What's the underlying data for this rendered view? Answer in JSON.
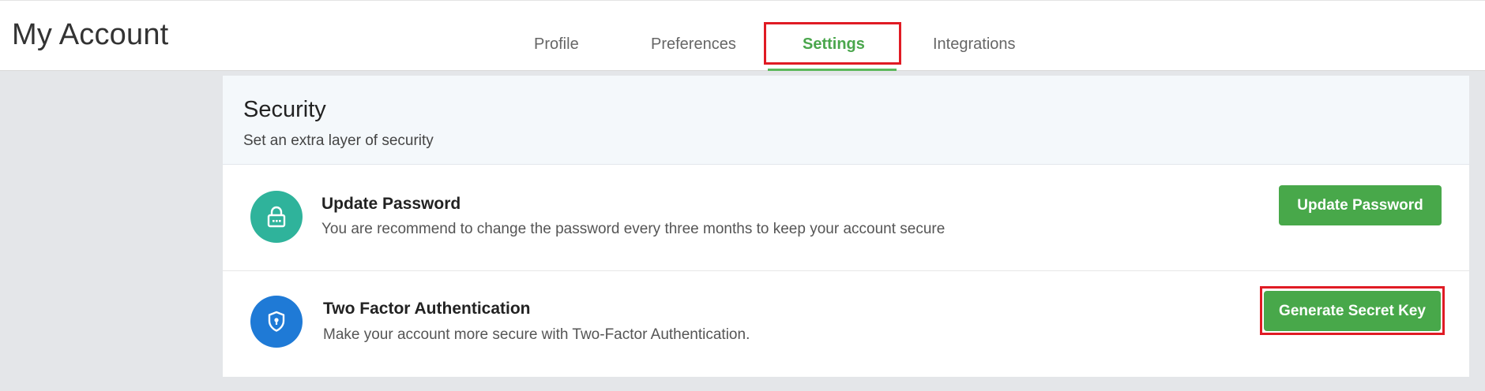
{
  "page": {
    "title": "My Account"
  },
  "tabs": [
    {
      "label": "Profile",
      "active": false
    },
    {
      "label": "Preferences",
      "active": false
    },
    {
      "label": "Settings",
      "active": true
    },
    {
      "label": "Integrations",
      "active": false
    }
  ],
  "security": {
    "title": "Security",
    "subtitle": "Set an extra layer of security",
    "items": [
      {
        "icon": "lock-icon",
        "title": "Update Password",
        "description": "You are recommend to change the password every three months to keep your account secure",
        "button_label": "Update Password"
      },
      {
        "icon": "shield-icon",
        "title": "Two Factor Authentication",
        "description": "Make your account more secure with Two-Factor Authentication.",
        "button_label": "Generate Secret Key"
      }
    ]
  },
  "colors": {
    "accent_green": "#48a84a",
    "active_tab": "#4aa64c",
    "lock_circle": "#2fb39b",
    "shield_circle": "#1f7ad6",
    "highlight": "#e01b24"
  }
}
